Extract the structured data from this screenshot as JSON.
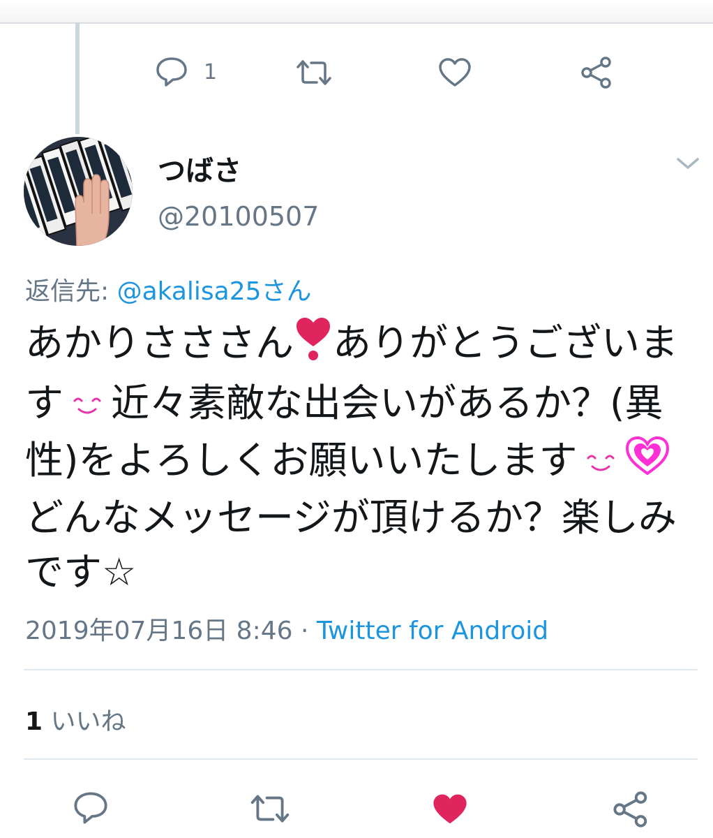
{
  "previous_tweet": {
    "reply_count": "1"
  },
  "tweet": {
    "display_name": "つばさ",
    "handle": "@20100507",
    "reply_to_label": "返信先: ",
    "reply_to_handle": "@akalisa25さん",
    "text_parts": [
      "あかりさささん",
      "ありがとうございます",
      "近々素敵な出会いがあるか？(異性)をよろしくお願いいたします",
      "どんなメッセージが頂けるか？楽しみです☆"
    ],
    "timestamp": "2019年07月16日 8:46",
    "separator": " · ",
    "source": "Twitter for Android",
    "likes_count": "1",
    "likes_label": " いいね"
  },
  "colors": {
    "liked": "#e0245e",
    "link": "#1b95e0",
    "muted": "#657786"
  },
  "icons": [
    "reply-icon",
    "retweet-icon",
    "like-icon",
    "share-icon",
    "caret-down-icon",
    "heart-emoji",
    "smile-emoji",
    "sparkle-heart-emoji"
  ]
}
